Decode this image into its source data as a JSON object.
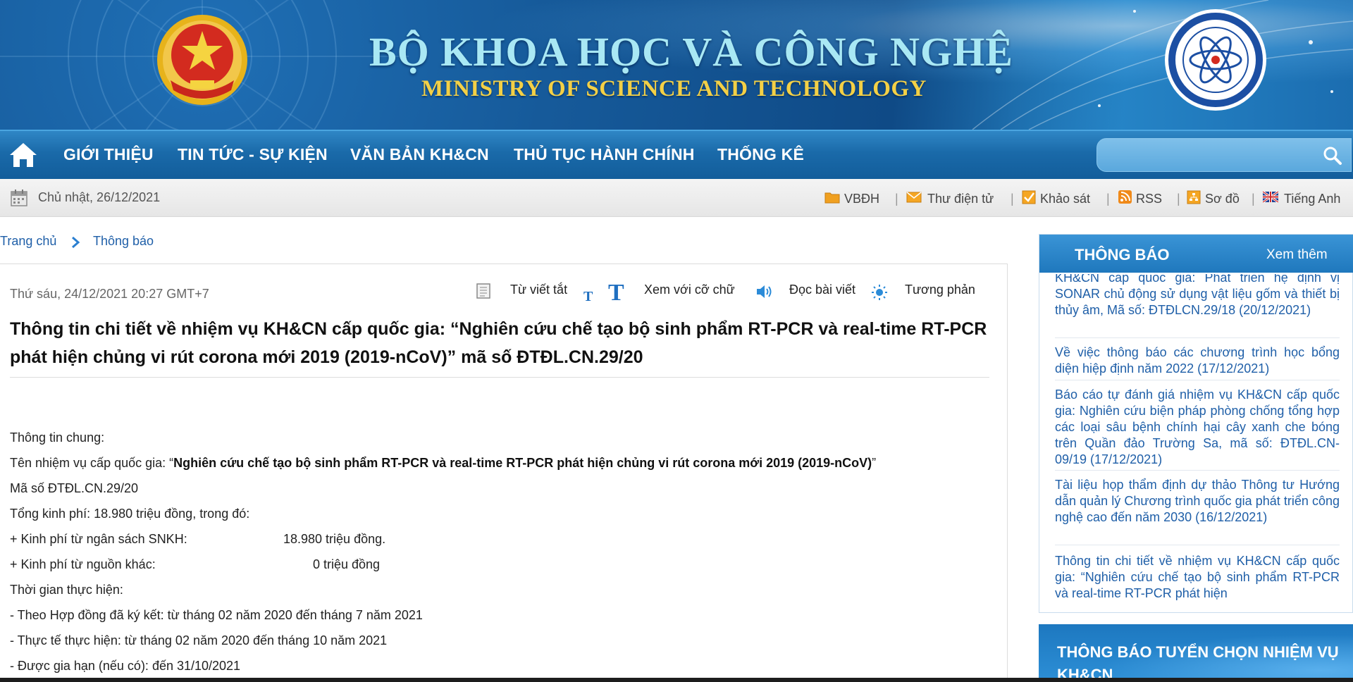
{
  "header": {
    "title_vn": "BỘ KHOA HỌC VÀ CÔNG NGHỆ",
    "title_en": "MINISTRY OF SCIENCE AND TECHNOLOGY",
    "emblem_icon": "national-emblem-icon",
    "logo_icon": "ministry-logo-icon"
  },
  "nav": {
    "items": [
      {
        "label": "GIỚI THIỆU"
      },
      {
        "label": "TIN TỨC - SỰ KIỆN"
      },
      {
        "label": "VĂN BẢN KH&CN"
      },
      {
        "label": "THỦ TỤC HÀNH CHÍNH"
      },
      {
        "label": "THỐNG KÊ"
      }
    ],
    "search_placeholder": ""
  },
  "infobar": {
    "date": "Chủ nhật, 26/12/2021",
    "links": [
      {
        "label": "VBĐH",
        "icon": "folder-icon"
      },
      {
        "label": "Thư điện tử",
        "icon": "envelope-icon"
      },
      {
        "label": "Khảo sát",
        "icon": "checkbox-icon"
      },
      {
        "label": "RSS",
        "icon": "rss-icon"
      },
      {
        "label": "Sơ đồ",
        "icon": "sitemap-icon"
      },
      {
        "label": "Tiếng Anh",
        "icon": "uk-flag-icon"
      }
    ]
  },
  "breadcrumb": {
    "home": "Trang chủ",
    "current": "Thông báo"
  },
  "article": {
    "date": "Thứ sáu, 24/12/2021 20:27 GMT+7",
    "tools": {
      "abbr": "Từ viết tắt",
      "font_size": "Xem với cỡ chữ",
      "read": "Đọc bài viết",
      "contrast": "Tương phản"
    },
    "title": "Thông tin chi tiết về nhiệm vụ KH&CN cấp quốc gia: “Nghiên cứu chế tạo bộ sinh phẩm RT-PCR và real-time RT-PCR phát hiện chủng vi rút corona mới 2019 (2019-nCoV)” mã số ĐTĐL.CN.29/20",
    "body": {
      "general": "Thông tin chung:",
      "task_name_label": "Tên nhiệm vụ cấp quốc gia: “",
      "task_name": "Nghiên cứu chế tạo bộ sinh phẩm RT-PCR và real-time RT-PCR phát hiện chủng vi rút corona mới 2019 (2019-nCoV)",
      "task_name_close": "”",
      "code": "Mã số ĐTĐL.CN.29/20",
      "total_budget": "Tổng kinh phí: 18.980 triệu đồng, trong đó:",
      "budget_snkh_label": "+ Kinh phí từ ngân sách SNKH:",
      "budget_snkh_value": "18.980 triệu đồng.",
      "budget_other_label": "+ Kinh phí từ nguồn khác:",
      "budget_other_value": "0 triệu đồng",
      "duration": "Thời gian thực hiện:",
      "contract": "- Theo Hợp đồng đã ký kết: từ tháng 02 năm 2020 đến tháng 7 năm 2021",
      "actual": "- Thực tế thực hiện: từ tháng 02 năm 2020 đến tháng 10 năm 2021",
      "extension": "- Được gia hạn (nếu có): đến 31/10/2021"
    }
  },
  "sidebar": {
    "title": "THÔNG BÁO",
    "more": "Xem thêm",
    "items": [
      {
        "text": "KH&CN cấp quốc gia: Phát triển hệ định vị SONAR chủ động sử dụng vật liệu gốm và thiết bị thủy âm, Mã số: ĐTĐLCN.29/18 (20/12/2021)"
      },
      {
        "text": "Về việc thông báo các chương trình học bổng diện hiệp định năm 2022 (17/12/2021)"
      },
      {
        "text": "Báo cáo tự đánh giá nhiệm vụ KH&CN cấp quốc gia: Nghiên cứu biện pháp phòng chống tổng hợp các loại sâu bệnh chính hại cây xanh che bóng trên Quần đảo Trường Sa, mã số: ĐTĐL.CN-09/19 (17/12/2021)"
      },
      {
        "text": "Tài liệu họp thẩm định dự thảo Thông tư Hướng dẫn quản lý Chương trình quốc gia phát triển công nghệ cao đến năm 2030 (16/12/2021)"
      },
      {
        "text": "Thông tin chi tiết về nhiệm vụ KH&CN cấp quốc gia: “Nghiên cứu chế tạo bộ sinh phẩm RT-PCR và real-time RT-PCR phát hiện"
      }
    ]
  },
  "promo": {
    "title": "THÔNG BÁO TUYỂN CHỌN NHIỆM VỤ KH&CN"
  },
  "colors": {
    "nav_bg": "#1a6aa9",
    "link": "#1f5fa8",
    "title_vn": "#a9e8f4",
    "title_en": "#f3d046"
  }
}
